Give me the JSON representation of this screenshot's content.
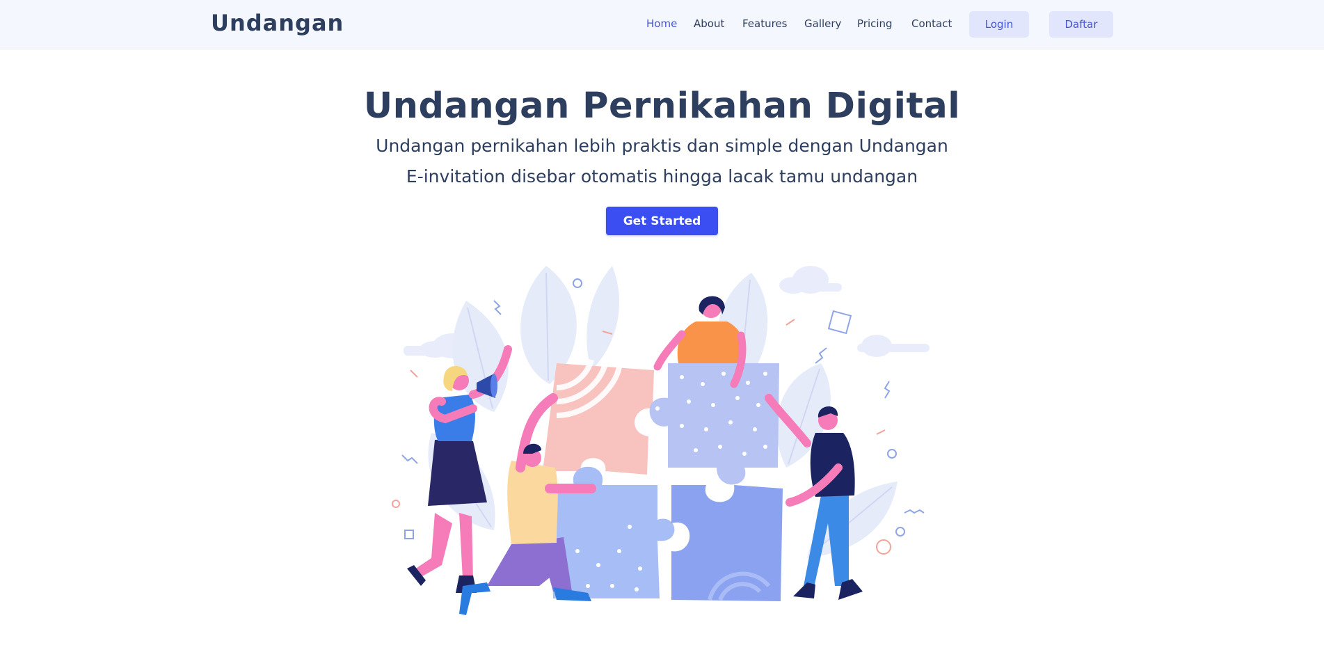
{
  "navbar": {
    "brand": "Undangan",
    "links": [
      {
        "label": "Home",
        "active": true
      },
      {
        "label": "About",
        "active": false
      },
      {
        "label": "Features",
        "active": false
      },
      {
        "label": "Gallery",
        "active": false
      },
      {
        "label": "Pricing",
        "active": false
      },
      {
        "label": "Contact",
        "active": false
      }
    ],
    "login_label": "Login",
    "register_label": "Daftar"
  },
  "hero": {
    "title": "Undangan Pernikahan Digital",
    "subtitle_line1": "Undangan pernikahan lebih praktis dan simple dengan Undangan",
    "subtitle_line2": "E-invitation disebar otomatis hingga lacak tamu undangan",
    "cta_label": "Get Started",
    "illustration": "people-assembling-puzzle-illustration"
  },
  "colors": {
    "accent": "#3b4ef1",
    "active_link": "#4453d6",
    "text": "#2d3e5e",
    "nav_background": "#f5f7ff",
    "nav_button_background": "#e1e6fd"
  }
}
